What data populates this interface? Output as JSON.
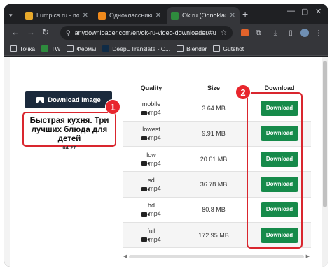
{
  "browser": {
    "tabs": [
      {
        "title": "Lumpics.ru - помощ",
        "favicon_color": "#e8a92b",
        "favicon_letter": ""
      },
      {
        "title": "Одноклассники",
        "favicon_color": "#f08a1c",
        "favicon_letter": ""
      },
      {
        "title": "Ok.ru (Odnoklassnik",
        "favicon_color": "#2e8b3d",
        "favicon_letter": "",
        "active": true
      }
    ],
    "url": "anydownloader.com/en/ok-ru-video-downloader/#url..."
  },
  "bookmarks": [
    {
      "label": "Точка",
      "icon": "folder-icon"
    },
    {
      "label": "TW",
      "icon": "tw-icon"
    },
    {
      "label": "Фермы",
      "icon": "folder-icon"
    },
    {
      "label": "DeepL Translate - C...",
      "icon": "deepl-icon"
    },
    {
      "label": "Blender",
      "icon": "folder-icon"
    },
    {
      "label": "Gutshot",
      "icon": "folder-icon"
    }
  ],
  "page": {
    "download_image_label": "Download Image",
    "video_title": "Быстрая кухня. Три лучших блюда для детей",
    "video_duration": "04:27",
    "table_headers": {
      "quality": "Quality",
      "size": "Size",
      "download": "Download"
    },
    "rows": [
      {
        "quality": "mobile",
        "format": "mp4",
        "size": "3.64 MB",
        "button": "Download"
      },
      {
        "quality": "lowest",
        "format": "mp4",
        "size": "9.91 MB",
        "button": "Download"
      },
      {
        "quality": "low",
        "format": "mp4",
        "size": "20.61 MB",
        "button": "Download"
      },
      {
        "quality": "sd",
        "format": "mp4",
        "size": "36.78 MB",
        "button": "Download"
      },
      {
        "quality": "hd",
        "format": "mp4",
        "size": "80.8 MB",
        "button": "Download"
      },
      {
        "quality": "full",
        "format": "mp4",
        "size": "172.95 MB",
        "button": "Download"
      }
    ]
  },
  "annotations": {
    "step1": "1",
    "step2": "2"
  },
  "colors": {
    "download_button": "#168a4a",
    "highlight": "#d9262e",
    "image_button": "#1b2a3c"
  }
}
